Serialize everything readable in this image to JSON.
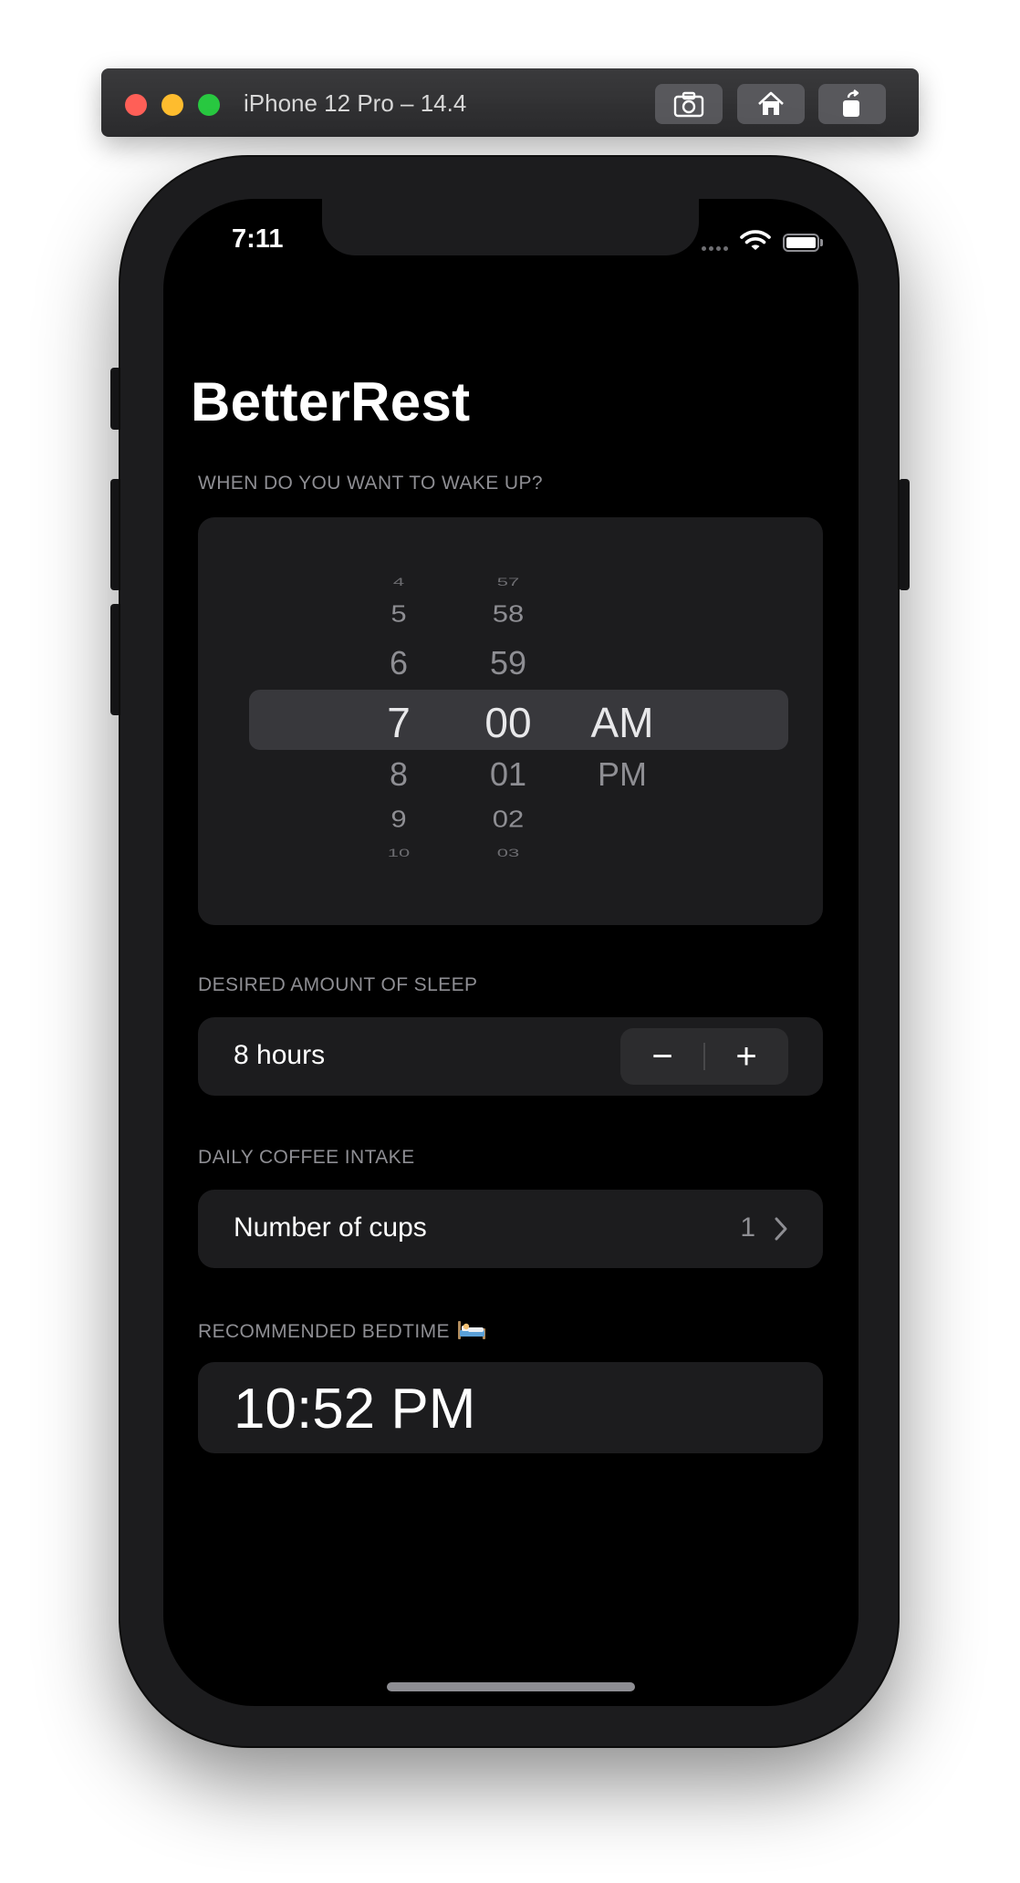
{
  "simulator": {
    "title": "iPhone 12 Pro – 14.4"
  },
  "status_bar": {
    "time": "7:11"
  },
  "app": {
    "title": "BetterRest"
  },
  "wake_up": {
    "header": "WHEN DO YOU WANT TO WAKE UP?",
    "hours": [
      "4",
      "5",
      "6",
      "7",
      "8",
      "9",
      "10"
    ],
    "minutes": [
      "57",
      "58",
      "59",
      "00",
      "01",
      "02",
      "03"
    ],
    "periods": [
      "AM",
      "PM"
    ],
    "selected": {
      "hour": "7",
      "minute": "00",
      "period": "AM"
    }
  },
  "sleep": {
    "header": "DESIRED AMOUNT OF SLEEP",
    "label": "8 hours",
    "decrement_label": "−",
    "increment_label": "+"
  },
  "coffee": {
    "header": "DAILY COFFEE INTAKE",
    "label": "Number of cups",
    "value": "1"
  },
  "bedtime": {
    "header": "RECOMMENDED BEDTIME",
    "value": "10:52 PM",
    "icon": "bed-icon"
  }
}
